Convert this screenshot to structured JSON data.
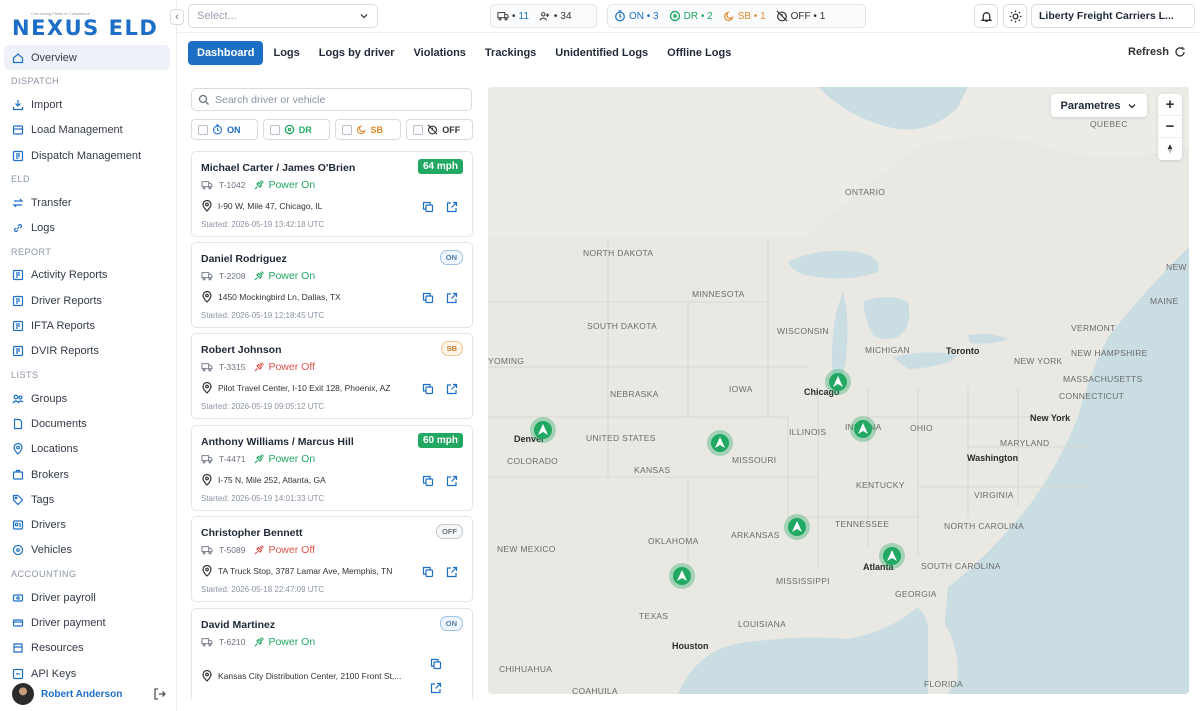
{
  "brand": {
    "name": "NEXUS ELD",
    "tagline": "Connecting Fleets to Compliance"
  },
  "sidebar": {
    "overview": "Overview",
    "sections": {
      "dispatch": "DISPATCH",
      "eld": "ELD",
      "report": "REPORT",
      "lists": "LISTS",
      "accounting": "ACCOUNTING"
    },
    "items": {
      "import": "Import",
      "load_management": "Load Management",
      "dispatch_management": "Dispatch Management",
      "transfer": "Transfer",
      "logs": "Logs",
      "activity_reports": "Activity Reports",
      "driver_reports": "Driver Reports",
      "ifta_reports": "IFTA Reports",
      "dvir_reports": "DVIR Reports",
      "groups": "Groups",
      "documents": "Documents",
      "locations": "Locations",
      "brokers": "Brokers",
      "tags": "Tags",
      "drivers": "Drivers",
      "vehicles": "Vehicles",
      "driver_payroll": "Driver payroll",
      "driver_payment": "Driver payment",
      "resources": "Resources",
      "api_keys": "API Keys"
    },
    "user": "Robert Anderson"
  },
  "topbar": {
    "select_placeholder": "Select...",
    "vehicles": "11",
    "drivers": "34",
    "on": "ON • 3",
    "dr": "DR • 2",
    "sb": "SB • 1",
    "off": "OFF • 1",
    "company": "Liberty Freight Carriers L..."
  },
  "tabs": [
    "Dashboard",
    "Logs",
    "Logs by driver",
    "Violations",
    "Trackings",
    "Unidentified Logs",
    "Offline Logs"
  ],
  "refresh": "Refresh",
  "search": {
    "placeholder": "Search driver or vehicle"
  },
  "filters": [
    "ON",
    "DR",
    "SB",
    "OFF"
  ],
  "drivers": [
    {
      "name": "Michael Carter / James O'Brien",
      "truck": "T-1042",
      "power": "Power On",
      "badge": "64 mph",
      "address": "I-90 W, Mile 47, Chicago, IL",
      "started": "Started: 2026-05-19 13:42:18 UTC"
    },
    {
      "name": "Daniel Rodriguez",
      "truck": "T-2208",
      "power": "Power On",
      "badge": "ON",
      "address": "1450 Mockingbird Ln, Dallas, TX",
      "started": "Started: 2026-05-19 12:18:45 UTC"
    },
    {
      "name": "Robert Johnson",
      "truck": "T-3315",
      "power": "Power Off",
      "badge": "SB",
      "address": "Pilot Travel Center, I-10 Exit 128, Phoenix, AZ",
      "started": "Started: 2026-05-19 09:05:12 UTC"
    },
    {
      "name": "Anthony Williams / Marcus Hill",
      "truck": "T-4471",
      "power": "Power On",
      "badge": "60 mph",
      "address": "I-75 N, Mile 252, Atlanta, GA",
      "started": "Started: 2026-05-19 14:01:33 UTC"
    },
    {
      "name": "Christopher Bennett",
      "truck": "T-5089",
      "power": "Power Off",
      "badge": "OFF",
      "address": "TA Truck Stop, 3787 Lamar Ave, Memphis, TN",
      "started": "Started: 2026-05-18 22:47:09 UTC"
    },
    {
      "name": "David Martinez",
      "truck": "T-6210",
      "power": "Power On",
      "badge": "ON",
      "address": "Kansas City Distribution Center, 2100 Front St,...",
      "started": ""
    }
  ],
  "map": {
    "parametres": "Parametres",
    "zoom_in": "+",
    "zoom_out": "−",
    "labels": {
      "quebec": "QUEBEC",
      "ontario": "ONTARIO",
      "north_dakota": "NORTH DAKOTA",
      "minnesota": "MINNESOTA",
      "south_dakota": "SOUTH DAKOTA",
      "wisconsin": "WISCONSIN",
      "michigan": "MICHIGAN",
      "yoming": "YOMING",
      "nebraska": "NEBRASKA",
      "iowa": "IOWA",
      "united_states": "UNITED STATES",
      "colorado": "COLORADO",
      "illinois": "ILLINOIS",
      "indiana": "INDIANA",
      "ohio": "OHIO",
      "kansas": "KANSAS",
      "missouri": "MISSOURI",
      "kentucky": "KENTUCKY",
      "virginia": "VIRGINIA",
      "tennessee": "TENNESSEE",
      "north_carolina": "NORTH CAROLINA",
      "new_mexico": "NEW MEXICO",
      "oklahoma": "OKLAHOMA",
      "arkansas": "ARKANSAS",
      "mississippi": "MISSISSIPPI",
      "south_carolina": "SOUTH CAROLINA",
      "georgia": "GEORGIA",
      "texas": "TEXAS",
      "louisiana": "LOUISIANA",
      "chihuahua": "CHIHUAHUA",
      "coahuila": "COAHUILA",
      "florida": "FLORIDA",
      "maine": "MAINE",
      "vermont": "VERMONT",
      "new_york": "NEW YORK",
      "new_hampshire": "NEW HAMPSHIRE",
      "massachusetts": "MASSACHUSETTS",
      "connecticut": "CONNECTICUT",
      "maryland": "MARYLAND",
      "new_b": "NEW B"
    },
    "cities": {
      "toronto": "Toronto",
      "chicago": "Chicago",
      "denver": "Denver",
      "new_york": "New York",
      "washington": "Washington",
      "atlanta": "Atlanta",
      "houston": "Houston"
    }
  },
  "colors": {
    "accent": "#1d6fc6",
    "on": "#1d6fc6",
    "dr": "#21a862",
    "sb": "#e08a2a",
    "off": "#555555",
    "power_on": "#21a862",
    "power_off": "#e0524a"
  }
}
